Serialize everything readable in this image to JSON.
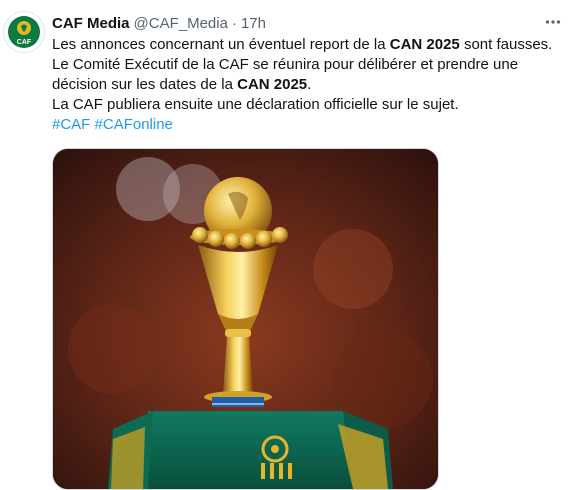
{
  "tweet": {
    "display_name": "CAF Media",
    "handle": "@CAF_Media",
    "separator": "·",
    "time": "17h",
    "avatar_text": "CAF",
    "more_icon": "more-horizontal-icon",
    "body": {
      "l1_a": "Les annonces concernant un éventuel report de la ",
      "l1_b": "CAN 2025",
      "l1_c": " sont fausses.",
      "l2": "Le Comité Exécutif de la CAF se réunira pour délibérer et prendre une",
      "l3_a": "décision sur les dates de la ",
      "l3_b": "CAN 2025",
      "l3_c": ".",
      "l4": "La CAF publiera ensuite une déclaration officielle sur le sujet.",
      "hashtag_1": "#CAF",
      "hashtag_2": "#CAFonline"
    },
    "media": {
      "image_name": "africa-cup-of-nations-trophy-photo"
    },
    "colors": {
      "hashtag": "#1d9bf0",
      "secondary_text": "#536471",
      "caf_green": "#0a7a3e",
      "trophy_gold": "#d9a521"
    }
  }
}
